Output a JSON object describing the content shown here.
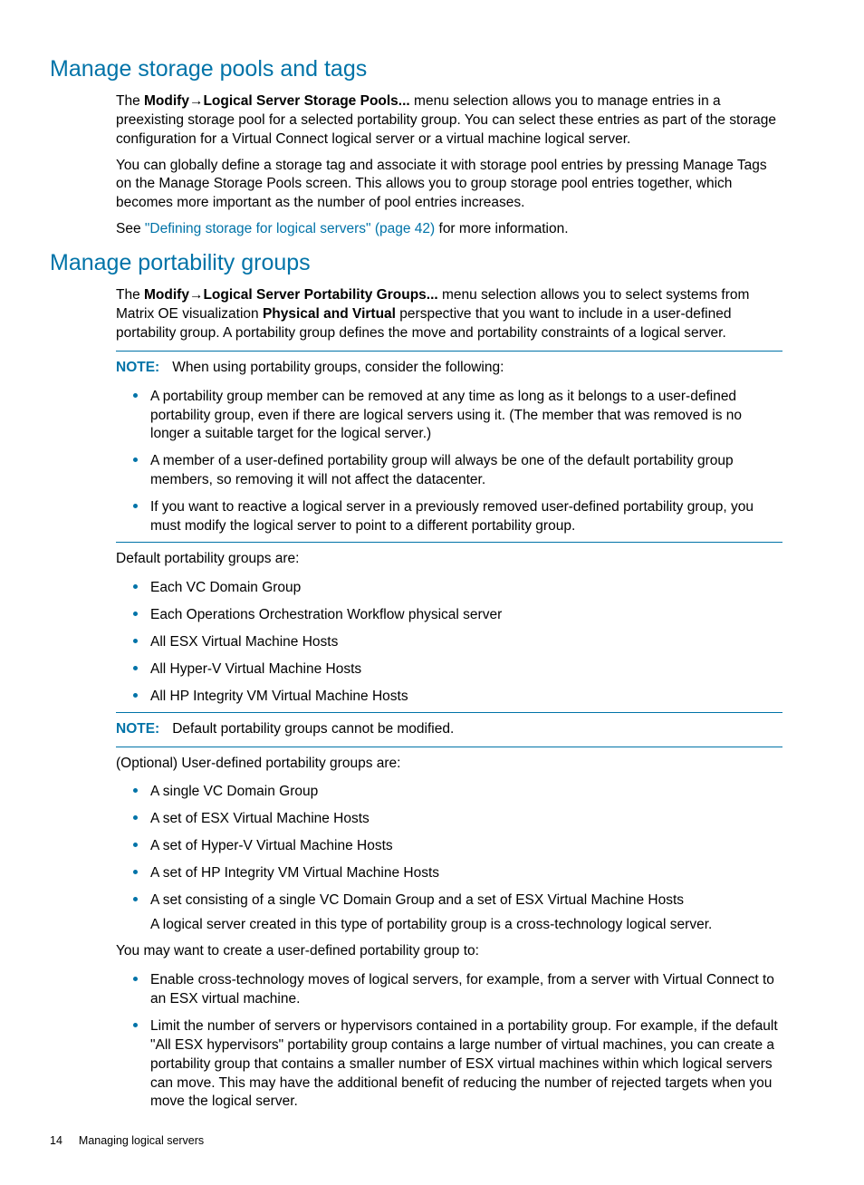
{
  "heading1": "Manage storage pools and tags",
  "sec1": {
    "p1_pre": "The ",
    "p1_bold": "Modify→Logical Server Storage Pools...",
    "p1_post": " menu selection allows you to manage entries in a preexisting storage pool for a selected portability group. You can select these entries as part of the storage configuration for a Virtual Connect logical server or a virtual machine logical server.",
    "p2": "You can globally define a storage tag and associate it with storage pool entries by pressing Manage Tags on the Manage Storage Pools screen. This allows you to group storage pool entries together, which becomes more important as the number of pool entries increases.",
    "p3_pre": "See ",
    "p3_link": "\"Defining storage for logical servers\" (page 42)",
    "p3_post": " for more information."
  },
  "heading2": "Manage portability groups",
  "sec2": {
    "p1_pre": "The ",
    "p1_bold1": "Modify→Logical Server Portability Groups...",
    "p1_mid": " menu selection allows you to select systems from Matrix OE visualization ",
    "p1_bold2": "Physical and Virtual",
    "p1_post": " perspective that you want to include in a user-defined portability group. A portability group defines the move and portability constraints of a logical server.",
    "note1_label": "NOTE:",
    "note1_text": "When using portability groups, consider the following:",
    "note1_items": [
      "A portability group member can be removed at any time as long as it belongs to a user-defined portability group, even if there are logical servers using it. (The member that was removed is no longer a suitable target for the logical server.)",
      "A member of a user-defined portability group will always be one of the default portability group members, so removing it will not affect the datacenter.",
      "If you want to reactive a logical server in a previously removed user-defined portability group, you must modify the logical server to point to a different portability group."
    ],
    "p2": "Default portability groups are:",
    "default_groups": [
      "Each  VC Domain Group",
      "Each Operations Orchestration Workflow physical server",
      "All ESX Virtual Machine Hosts",
      "All Hyper-V Virtual Machine Hosts",
      "All HP Integrity VM Virtual Machine Hosts"
    ],
    "note2_label": "NOTE:",
    "note2_text": "Default portability groups cannot be modified.",
    "p3": "(Optional) User-defined portability groups are:",
    "user_groups": [
      "A single  VC Domain Group",
      "A set of ESX Virtual Machine Hosts",
      "A set of Hyper-V Virtual Machine Hosts",
      "A set of HP Integrity VM Virtual Machine Hosts"
    ],
    "user_group_last": "A set consisting of a single  VC Domain Group and a set of ESX Virtual Machine Hosts",
    "user_group_last_sub": "A logical server created in this type of portability group is a cross-technology logical server.",
    "p4": "You may want to create a user-defined portability group to:",
    "reasons": [
      "Enable cross-technology moves of logical servers, for example, from a server with Virtual Connect to an ESX virtual machine.",
      "Limit the number of servers or hypervisors contained in a portability group. For example, if the default \"All ESX hypervisors\" portability group contains a large number of virtual machines, you can create a portability group that contains a smaller number of ESX virtual machines within which logical servers can move. This may have the additional benefit of reducing the number of rejected targets when you move the logical server."
    ]
  },
  "footer": {
    "pagenum": "14",
    "chapter": "Managing logical servers"
  }
}
